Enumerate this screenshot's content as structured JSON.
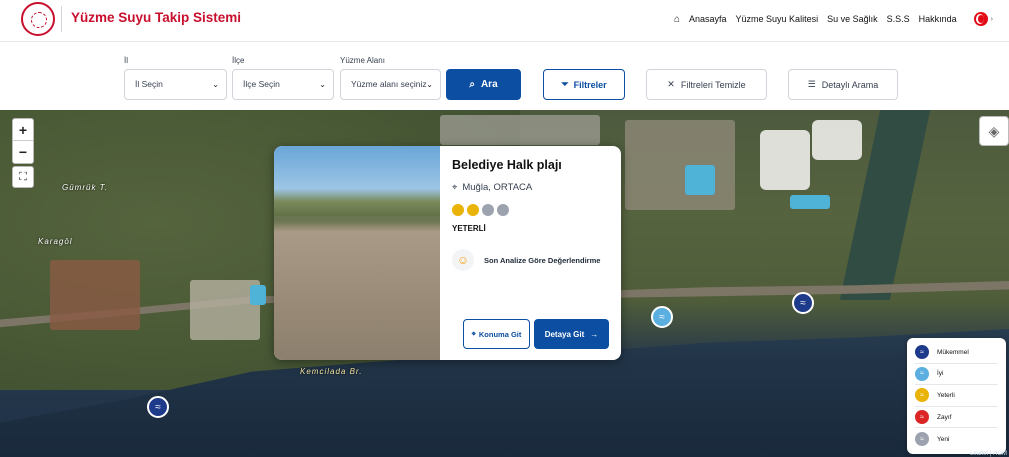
{
  "header": {
    "site_title": "Yüzme Suyu Takip Sistemi",
    "nav": [
      "Anasayfa",
      "Yüzme Suyu Kalitesi",
      "Su ve Sağlık",
      "S.S.S",
      "Hakkında"
    ]
  },
  "filters": {
    "il_label": "İl",
    "il_value": "İl Seçin",
    "ilce_label": "İlçe",
    "ilce_value": "İlçe Seçin",
    "alan_label": "Yüzme Alanı",
    "alan_value": "Yüzme alanı seçiniz",
    "search_label": "Ara",
    "filters_label": "Filtreler",
    "clear_label": "Filtreleri Temizle",
    "advanced_label": "Detaylı Arama"
  },
  "map": {
    "labels": [
      "Gümrük T.",
      "Karagöl",
      "Kemcilada Br."
    ],
    "attribution": "Leaflet | HGM"
  },
  "popup": {
    "name": "Belediye Halk plajı",
    "location": "Muğla, ORTACA",
    "rating_colors": [
      "#eab308",
      "#eab308",
      "#9ca3af",
      "#9ca3af"
    ],
    "status": "YETERLİ",
    "evaluation": "Son Analize Göre Değerlendirme",
    "location_button": "Konuma Git",
    "detail_button": "Detaya Git"
  },
  "legend": [
    {
      "label": "Mükemmel",
      "color": "#1e3a8a"
    },
    {
      "label": "İyi",
      "color": "#5aaee0"
    },
    {
      "label": "Yeterli",
      "color": "#eab308"
    },
    {
      "label": "Zayıf",
      "color": "#dc2626"
    },
    {
      "label": "Yeni",
      "color": "#9ca3af"
    }
  ]
}
